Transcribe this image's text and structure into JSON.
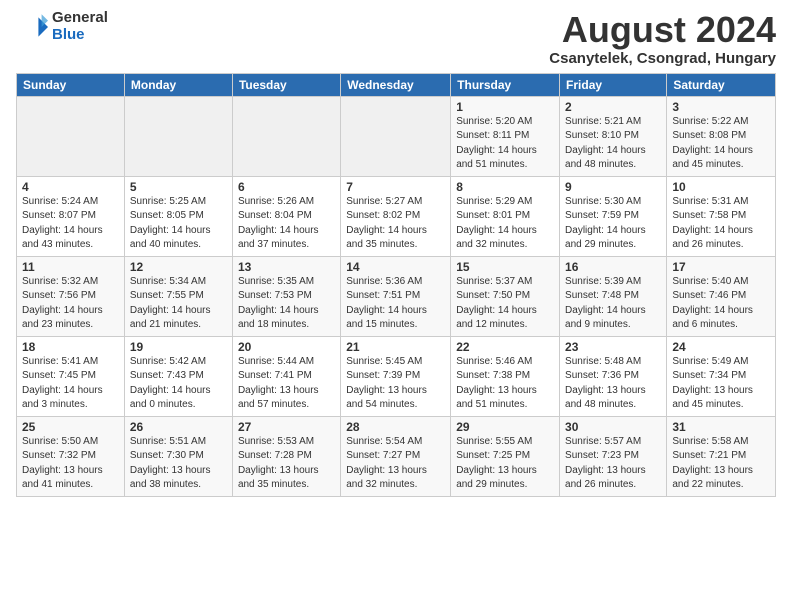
{
  "header": {
    "logo_general": "General",
    "logo_blue": "Blue",
    "month_title": "August 2024",
    "location": "Csanytelek, Csongrad, Hungary"
  },
  "weekdays": [
    "Sunday",
    "Monday",
    "Tuesday",
    "Wednesday",
    "Thursday",
    "Friday",
    "Saturday"
  ],
  "weeks": [
    [
      {
        "day": "",
        "info": ""
      },
      {
        "day": "",
        "info": ""
      },
      {
        "day": "",
        "info": ""
      },
      {
        "day": "",
        "info": ""
      },
      {
        "day": "1",
        "info": "Sunrise: 5:20 AM\nSunset: 8:11 PM\nDaylight: 14 hours\nand 51 minutes."
      },
      {
        "day": "2",
        "info": "Sunrise: 5:21 AM\nSunset: 8:10 PM\nDaylight: 14 hours\nand 48 minutes."
      },
      {
        "day": "3",
        "info": "Sunrise: 5:22 AM\nSunset: 8:08 PM\nDaylight: 14 hours\nand 45 minutes."
      }
    ],
    [
      {
        "day": "4",
        "info": "Sunrise: 5:24 AM\nSunset: 8:07 PM\nDaylight: 14 hours\nand 43 minutes."
      },
      {
        "day": "5",
        "info": "Sunrise: 5:25 AM\nSunset: 8:05 PM\nDaylight: 14 hours\nand 40 minutes."
      },
      {
        "day": "6",
        "info": "Sunrise: 5:26 AM\nSunset: 8:04 PM\nDaylight: 14 hours\nand 37 minutes."
      },
      {
        "day": "7",
        "info": "Sunrise: 5:27 AM\nSunset: 8:02 PM\nDaylight: 14 hours\nand 35 minutes."
      },
      {
        "day": "8",
        "info": "Sunrise: 5:29 AM\nSunset: 8:01 PM\nDaylight: 14 hours\nand 32 minutes."
      },
      {
        "day": "9",
        "info": "Sunrise: 5:30 AM\nSunset: 7:59 PM\nDaylight: 14 hours\nand 29 minutes."
      },
      {
        "day": "10",
        "info": "Sunrise: 5:31 AM\nSunset: 7:58 PM\nDaylight: 14 hours\nand 26 minutes."
      }
    ],
    [
      {
        "day": "11",
        "info": "Sunrise: 5:32 AM\nSunset: 7:56 PM\nDaylight: 14 hours\nand 23 minutes."
      },
      {
        "day": "12",
        "info": "Sunrise: 5:34 AM\nSunset: 7:55 PM\nDaylight: 14 hours\nand 21 minutes."
      },
      {
        "day": "13",
        "info": "Sunrise: 5:35 AM\nSunset: 7:53 PM\nDaylight: 14 hours\nand 18 minutes."
      },
      {
        "day": "14",
        "info": "Sunrise: 5:36 AM\nSunset: 7:51 PM\nDaylight: 14 hours\nand 15 minutes."
      },
      {
        "day": "15",
        "info": "Sunrise: 5:37 AM\nSunset: 7:50 PM\nDaylight: 14 hours\nand 12 minutes."
      },
      {
        "day": "16",
        "info": "Sunrise: 5:39 AM\nSunset: 7:48 PM\nDaylight: 14 hours\nand 9 minutes."
      },
      {
        "day": "17",
        "info": "Sunrise: 5:40 AM\nSunset: 7:46 PM\nDaylight: 14 hours\nand 6 minutes."
      }
    ],
    [
      {
        "day": "18",
        "info": "Sunrise: 5:41 AM\nSunset: 7:45 PM\nDaylight: 14 hours\nand 3 minutes."
      },
      {
        "day": "19",
        "info": "Sunrise: 5:42 AM\nSunset: 7:43 PM\nDaylight: 14 hours\nand 0 minutes."
      },
      {
        "day": "20",
        "info": "Sunrise: 5:44 AM\nSunset: 7:41 PM\nDaylight: 13 hours\nand 57 minutes."
      },
      {
        "day": "21",
        "info": "Sunrise: 5:45 AM\nSunset: 7:39 PM\nDaylight: 13 hours\nand 54 minutes."
      },
      {
        "day": "22",
        "info": "Sunrise: 5:46 AM\nSunset: 7:38 PM\nDaylight: 13 hours\nand 51 minutes."
      },
      {
        "day": "23",
        "info": "Sunrise: 5:48 AM\nSunset: 7:36 PM\nDaylight: 13 hours\nand 48 minutes."
      },
      {
        "day": "24",
        "info": "Sunrise: 5:49 AM\nSunset: 7:34 PM\nDaylight: 13 hours\nand 45 minutes."
      }
    ],
    [
      {
        "day": "25",
        "info": "Sunrise: 5:50 AM\nSunset: 7:32 PM\nDaylight: 13 hours\nand 41 minutes."
      },
      {
        "day": "26",
        "info": "Sunrise: 5:51 AM\nSunset: 7:30 PM\nDaylight: 13 hours\nand 38 minutes."
      },
      {
        "day": "27",
        "info": "Sunrise: 5:53 AM\nSunset: 7:28 PM\nDaylight: 13 hours\nand 35 minutes."
      },
      {
        "day": "28",
        "info": "Sunrise: 5:54 AM\nSunset: 7:27 PM\nDaylight: 13 hours\nand 32 minutes."
      },
      {
        "day": "29",
        "info": "Sunrise: 5:55 AM\nSunset: 7:25 PM\nDaylight: 13 hours\nand 29 minutes."
      },
      {
        "day": "30",
        "info": "Sunrise: 5:57 AM\nSunset: 7:23 PM\nDaylight: 13 hours\nand 26 minutes."
      },
      {
        "day": "31",
        "info": "Sunrise: 5:58 AM\nSunset: 7:21 PM\nDaylight: 13 hours\nand 22 minutes."
      }
    ]
  ]
}
